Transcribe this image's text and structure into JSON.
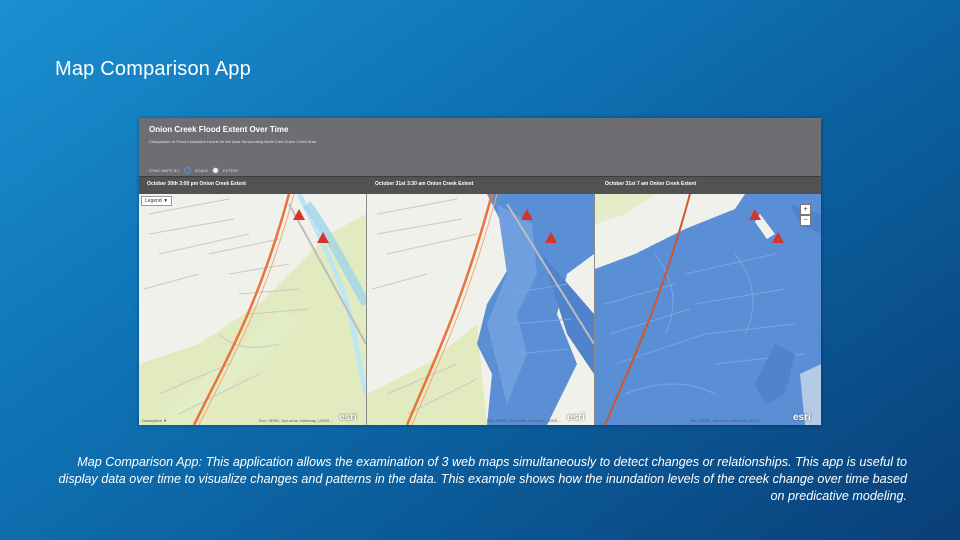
{
  "slide": {
    "title": "Map Comparison App",
    "caption": "Map Comparison App: This application allows the examination of 3 web maps simultaneously to detect changes or relationships. This app is useful to display data over time to visualize changes and patterns in the data. This example shows how the inundation levels of the creek change over time based on predicative modeling."
  },
  "app": {
    "title": "Onion Creek Flood Extent Over Time",
    "subtitle": "Comparison of Flood Inundation Levels for the Area Surrounding North East Onion Creek Area",
    "mode_label": "SYNC MAPS BY:",
    "mode_option_1": "SCALE",
    "mode_option_2": "EXTENT",
    "panels": [
      {
        "label": "October 30th 3:00 pm Onion Creek Extent"
      },
      {
        "label": "October 31st 3:30 am Onion Creek Extent"
      },
      {
        "label": "October 31st 7 am Onion Creek Extent"
      }
    ],
    "legend_button": "Legend ▼",
    "description_button": "Description ▼",
    "attribution": "Esri, HERE, DeLorme, Intermap, USGS...",
    "esri_logo": "esri",
    "zoom_in": "+",
    "zoom_out": "−"
  },
  "colors": {
    "flood_water": "#5a8fd6",
    "creek": "#bfe4f2",
    "greenbelt": "#dfeab9",
    "land": "#f1f1ec",
    "highway": "#e8743b",
    "header_bar": "#6c6e71"
  }
}
